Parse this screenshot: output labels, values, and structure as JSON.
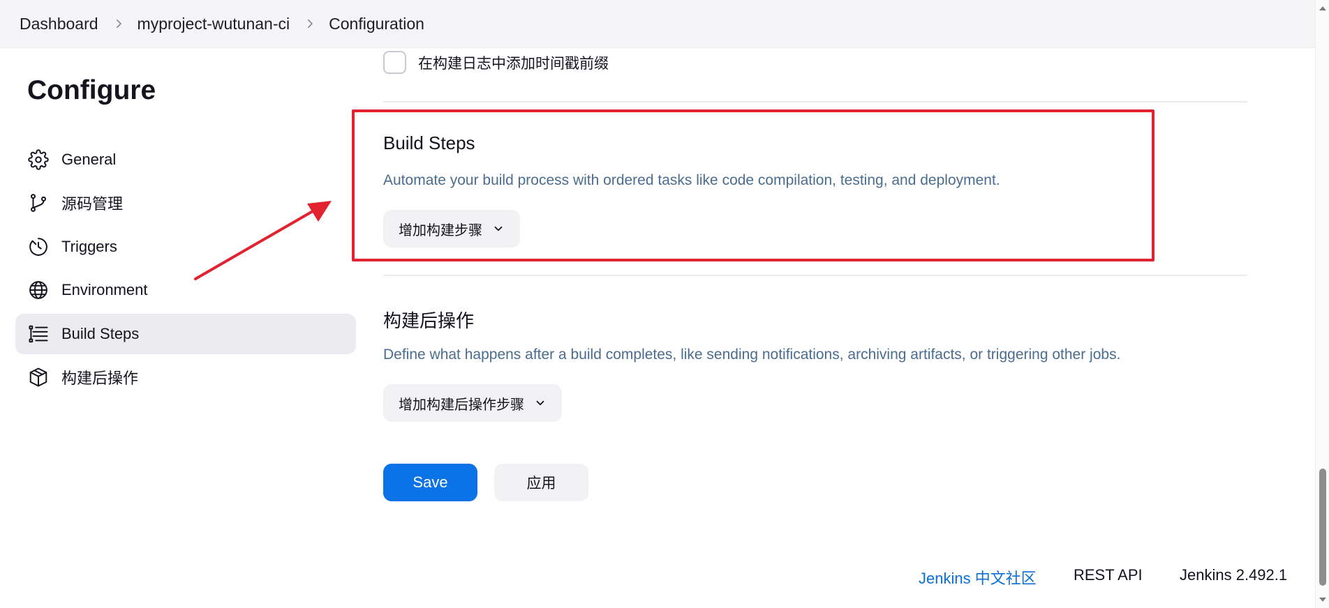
{
  "breadcrumb": {
    "items": [
      "Dashboard",
      "myproject-wutunan-ci",
      "Configuration"
    ]
  },
  "sidebar": {
    "title": "Configure",
    "items": [
      {
        "label": "General",
        "icon": "gear-icon"
      },
      {
        "label": "源码管理",
        "icon": "branch-icon"
      },
      {
        "label": "Triggers",
        "icon": "clock-icon"
      },
      {
        "label": "Environment",
        "icon": "globe-icon"
      },
      {
        "label": "Build Steps",
        "icon": "list-icon",
        "active": true
      },
      {
        "label": "构建后操作",
        "icon": "package-icon"
      }
    ]
  },
  "main": {
    "timestamp_checkbox": {
      "label": "在构建日志中添加时间戳前缀",
      "checked": false
    },
    "build_steps": {
      "title": "Build Steps",
      "description": "Automate your build process with ordered tasks like code compilation, testing, and deployment.",
      "add_button": "增加构建步骤"
    },
    "post_build": {
      "title": "构建后操作",
      "description": "Define what happens after a build completes, like sending notifications, archiving artifacts, or triggering other jobs.",
      "add_button": "增加构建后操作步骤"
    },
    "save_label": "Save",
    "apply_label": "应用"
  },
  "footer": {
    "community_link": "Jenkins 中文社区",
    "rest_api": "REST API",
    "version": "Jenkins 2.492.1"
  },
  "colors": {
    "accent": "#0b72e7",
    "annotation": "#e2232f",
    "description": "#4a6d8f",
    "link": "#0b6fd6"
  }
}
